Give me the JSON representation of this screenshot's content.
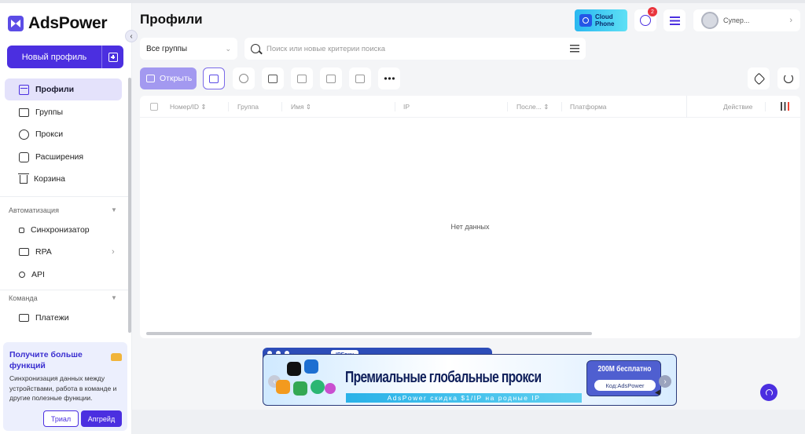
{
  "app": {
    "brand": "AdsPower"
  },
  "sidebar": {
    "new_profile_label": "Новый профиль",
    "items": [
      {
        "label": "Профили",
        "icon": "profile-icon",
        "active": true
      },
      {
        "label": "Группы",
        "icon": "folder-icon"
      },
      {
        "label": "Прокси",
        "icon": "proxy-icon"
      },
      {
        "label": "Расширения",
        "icon": "extension-icon"
      },
      {
        "label": "Корзина",
        "icon": "trash-icon"
      }
    ],
    "automation_title": "Автоматизация",
    "automation_items": [
      {
        "label": "Синхронизатор",
        "icon": "sync-icon"
      },
      {
        "label": "RPA",
        "icon": "rpa-icon"
      },
      {
        "label": "API",
        "icon": "api-icon"
      }
    ],
    "team_title": "Команда",
    "team_items": [
      {
        "label": "Платежи",
        "icon": "payment-icon"
      }
    ],
    "upsell": {
      "title": "Получите больше функций",
      "text": "Синхронизация данных между устройствами, работа в команде и другие полезные функции.",
      "trial_label": "Триал",
      "upgrade_label": "Апгрейд"
    }
  },
  "header": {
    "title": "Профили",
    "cloud_phone_line1": "Cloud",
    "cloud_phone_line2": "Phone",
    "notification_count": "2",
    "user_name": "Супер..."
  },
  "filters": {
    "group_select": "Все группы",
    "search_placeholder": "Поиск или новые критерии поиска"
  },
  "toolbar": {
    "open_label": "Открыть"
  },
  "table": {
    "columns": [
      "Номер/ID",
      "Группа",
      "Имя",
      "IP",
      "После...",
      "Платформа",
      "Действие"
    ],
    "empty_text": "Нет данных"
  },
  "banner": {
    "brand": "IPFoxy",
    "title": "Премиальные глобальные прокси",
    "subtitle": "AdsPower скидка $1/IP на родные IP",
    "cta": "200M бесплатно",
    "code": "Код:AdsPower"
  },
  "colors": {
    "accent": "#4b2fe0",
    "active_bg": "#e4e2fb",
    "open_button": "#a399f0"
  }
}
